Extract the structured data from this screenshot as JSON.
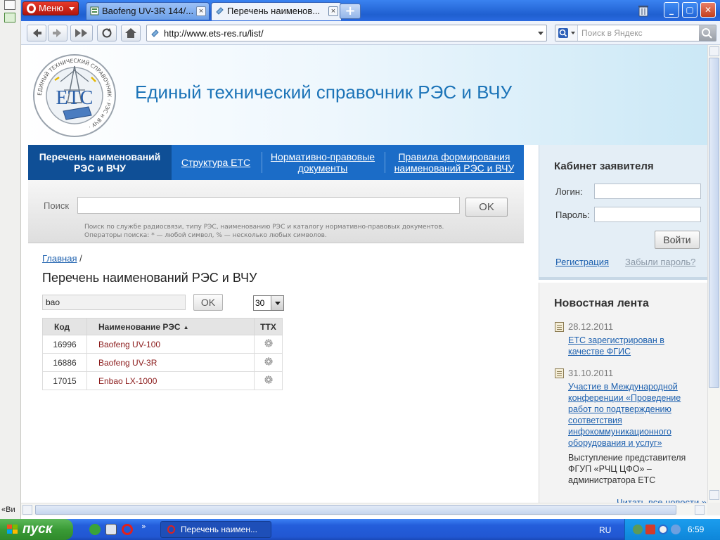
{
  "browser": {
    "menu_label": "Меню",
    "tabs": [
      {
        "title": "Baofeng UV-3R 144/..."
      },
      {
        "title": "Перечень наименов..."
      }
    ],
    "tab_close": "×",
    "new_tab": "+",
    "window_buttons": {
      "minimize": "_",
      "maximize": "▢",
      "close": "✕"
    },
    "url": "http://www.ets-res.ru/list/",
    "search_placeholder": "Поиск в Яндекс"
  },
  "site": {
    "title": "Единый технический справочник РЭС и ВЧУ",
    "logo_letters": "ЕТС",
    "logo_ring_text": "ЕДИНЫЙ ТЕХНИЧЕСКИЙ СПРАВОЧНИК · РЭС и ВЧУ ·"
  },
  "nav": {
    "items": [
      {
        "line1": "Перечень наименований",
        "line2": "РЭС и ВЧУ"
      },
      {
        "line1": "Структура ЕТС",
        "line2": ""
      },
      {
        "line1": "Нормативно-правовые",
        "line2": "документы"
      },
      {
        "line1": "Правила формирования",
        "line2": "наименований РЭС и ВЧУ"
      }
    ]
  },
  "search": {
    "label": "Поиск",
    "value": "",
    "button": "OK",
    "hint1": "Поиск по службе радиосвязи, типу РЭС, наименованию РЭС и каталогу нормативно-правовых документов.",
    "hint2": "Операторы поиска: * — любой символ, % — несколько любых символов."
  },
  "breadcrumb": {
    "home": "Главная",
    "sep": " /"
  },
  "page_title": "Перечень наименований РЭС и ВЧУ",
  "filter": {
    "value": "bao",
    "button": "OK",
    "per_page": "30"
  },
  "table": {
    "headers": {
      "code": "Код",
      "name": "Наименование РЭС",
      "ttx": "ТТХ"
    },
    "rows": [
      {
        "code": "16996",
        "name": "Baofeng UV-100"
      },
      {
        "code": "16886",
        "name": "Baofeng UV-3R"
      },
      {
        "code": "17015",
        "name": "Enbao LX-1000"
      }
    ]
  },
  "login": {
    "title": "Кабинет заявителя",
    "login_label": "Логин:",
    "password_label": "Пароль:",
    "submit": "Войти",
    "register": "Регистрация",
    "forgot": "Забыли пароль?"
  },
  "news": {
    "title": "Новостная лента",
    "items": [
      {
        "date": "28.12.2011",
        "link": "ЕТС зарегистрирован в качестве ФГИС",
        "text": ""
      },
      {
        "date": "31.10.2011",
        "link": "Участие в Международной конференции «Проведение работ по подтверждению соответствия инфокоммуникационного оборудования и услуг»",
        "text": "Выступление представителя ФГУП «РЧЦ ЦФО» – администратора ЕТС"
      }
    ],
    "more": "Читать все новости »"
  },
  "sidepanel": {
    "bottom_label": "«Ви"
  },
  "taskbar": {
    "start": "пуск",
    "chevrons": "»",
    "task_title": "Перечень наимен...",
    "lang": "RU",
    "clock": "6:59"
  },
  "colors": {
    "accent": "#1b6cc7",
    "link": "#1b5fae",
    "title": "#1c74b8",
    "result_name": "#8b1a1a"
  }
}
